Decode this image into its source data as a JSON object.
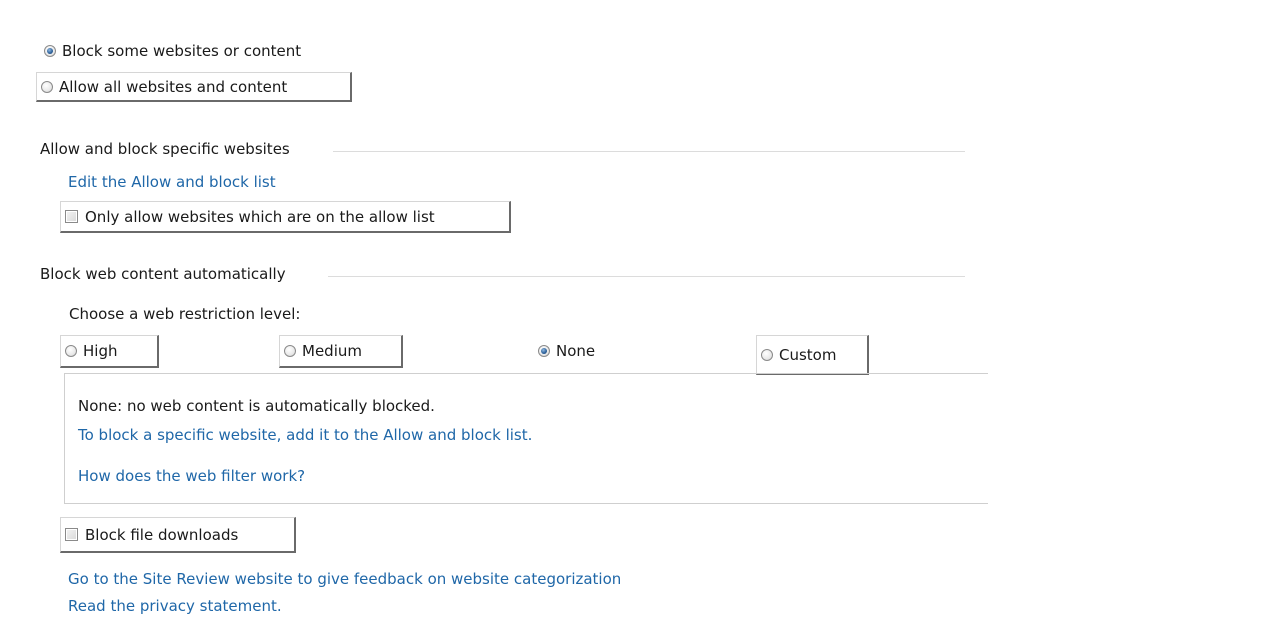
{
  "access_mode": {
    "block_label": "Block some websites or content",
    "block_selected": true,
    "allow_label": "Allow all websites and content",
    "allow_selected": false
  },
  "allow_block_section": {
    "heading": "Allow and block specific websites",
    "edit_link": "Edit the Allow and block list",
    "only_allow_label": "Only allow websites which are on the allow list",
    "only_allow_checked": false
  },
  "auto_block_section": {
    "heading": "Block web content automatically",
    "restriction_prompt": "Choose a web restriction level:",
    "levels": [
      {
        "label": "High",
        "selected": false
      },
      {
        "label": "Medium",
        "selected": false
      },
      {
        "label": "None",
        "selected": true
      },
      {
        "label": "Custom",
        "selected": false
      }
    ],
    "description": "None:  no web content is automatically blocked.",
    "block_specific_link": "To block a specific website, add it to the Allow and block list.",
    "how_filter_link": "How does the web filter work?"
  },
  "downloads": {
    "block_downloads_label": "Block file downloads",
    "block_downloads_checked": false
  },
  "footer_links": {
    "site_review": "Go to the Site Review website to give feedback on website categorization",
    "privacy": "Read the privacy statement."
  }
}
